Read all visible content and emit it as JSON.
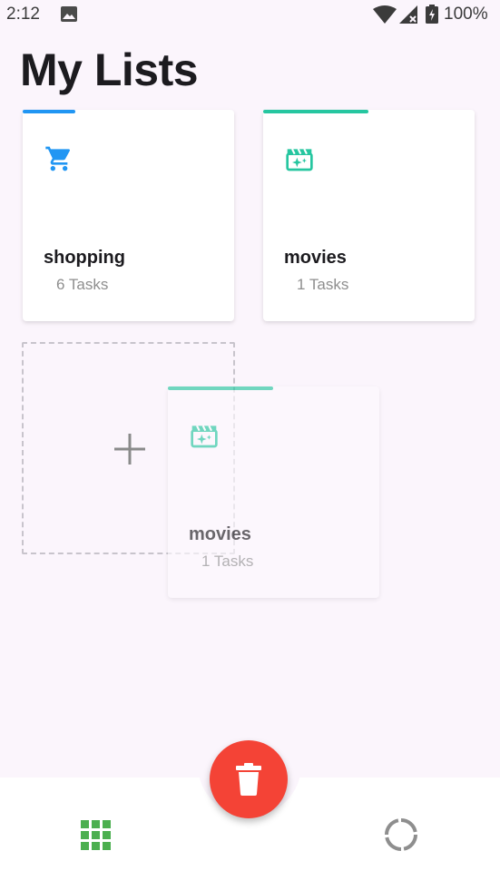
{
  "status_bar": {
    "time": "2:12",
    "battery": "100%"
  },
  "title": "My Lists",
  "lists": [
    {
      "name": "shopping",
      "count": "6 Tasks",
      "icon": "shopping-cart-icon",
      "color": "#2196f3"
    },
    {
      "name": "movies",
      "count": "1 Tasks",
      "icon": "movie-clapper-icon",
      "color": "#26c6a0"
    }
  ],
  "dragging_list": {
    "name": "movies",
    "count": "1 Tasks",
    "icon": "movie-clapper-icon",
    "color": "#26c6a0"
  },
  "add_tile": {
    "icon": "plus-icon"
  },
  "fab": {
    "icon": "trash-icon",
    "color": "#f44336"
  },
  "bottom_nav": [
    {
      "icon": "grid-icon",
      "color": "#4caf50",
      "active": true
    },
    {
      "icon": "progress-ring-icon",
      "color": "#8e8e8e",
      "active": false
    }
  ]
}
